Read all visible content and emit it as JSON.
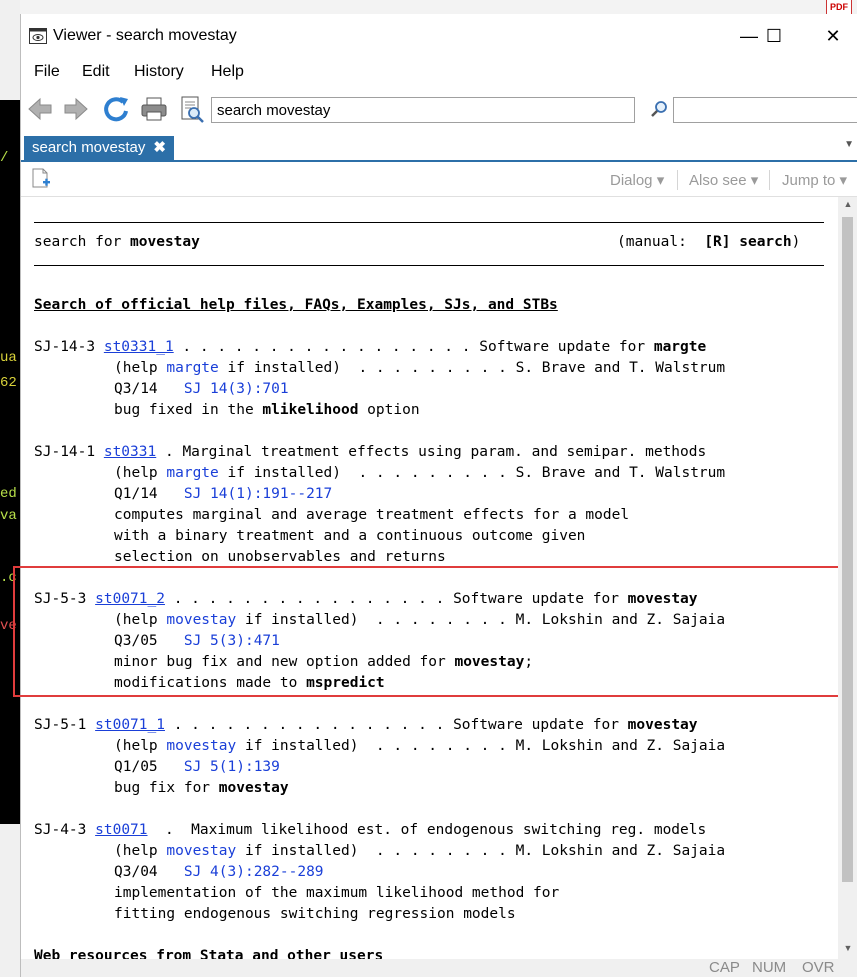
{
  "window": {
    "title": "Viewer - search movestay",
    "controls": {
      "minimize": "—",
      "maximize": "☐",
      "close": "✕"
    }
  },
  "menu": [
    "File",
    "Edit",
    "History",
    "Help"
  ],
  "toolbar": {
    "search_value": "search movestay",
    "find_value": ""
  },
  "tab": {
    "label": "search movestay",
    "close": "✖",
    "more": "▼"
  },
  "subtoolbar": {
    "dialog": "Dialog",
    "also_see": "Also see",
    "jump_to": "Jump to"
  },
  "console_fragments": [
    "/",
    "ua",
    "62",
    "ed",
    "va",
    ".c",
    "ve"
  ],
  "header": {
    "left_prefix": "search for ",
    "left_term": "movestay",
    "right_prefix": "(manual:  ",
    "right_ref": "[R] search",
    "right_suffix": ")"
  },
  "section_title": "Search of official help files, FAQs, Examples, SJs, and STBs",
  "entries": [
    {
      "id": "SJ-14-3",
      "link": "st0331_1",
      "dots": " . . . . . . . . . . . . . . . . . ",
      "desc_pre": "Software update for ",
      "desc_bold": "margte",
      "desc_post": "",
      "help_pre": "(help ",
      "help_cmd": "margte",
      "help_post": " if installed)  . . . . . . . . . ",
      "authors": "S. Brave and T. Walstrum",
      "issue": "Q3/14",
      "sj": "SJ 14(3):701",
      "notes": [
        {
          "pre": "bug fixed in the ",
          "bold": "mlikelihood",
          "post": " option"
        }
      ]
    },
    {
      "id": "SJ-14-1",
      "link": "st0331",
      "dots": " . ",
      "desc_pre": "Marginal treatment effects using param. and semipar. methods",
      "desc_bold": "",
      "desc_post": "",
      "help_pre": "(help ",
      "help_cmd": "margte",
      "help_post": " if installed)  . . . . . . . . . ",
      "authors": "S. Brave and T. Walstrum",
      "issue": "Q1/14",
      "sj": "SJ 14(1):191--217",
      "notes": [
        {
          "pre": "computes marginal and average treatment effects for a model",
          "bold": "",
          "post": ""
        },
        {
          "pre": "with a binary treatment and a continuous outcome given",
          "bold": "",
          "post": ""
        },
        {
          "pre": "selection on unobservables and returns",
          "bold": "",
          "post": ""
        }
      ]
    },
    {
      "id": "SJ-5-3",
      "link": "st0071_2",
      "dots": " . . . . . . . . . . . . . . . . ",
      "desc_pre": "Software update for ",
      "desc_bold": "movestay",
      "desc_post": "",
      "help_pre": "(help ",
      "help_cmd": "movestay",
      "help_post": " if installed)  . . . . . . . . ",
      "authors": "M. Lokshin and Z. Sajaia",
      "issue": "Q3/05",
      "sj": "SJ 5(3):471",
      "notes": [
        {
          "pre": "minor bug fix and new option added for ",
          "bold": "movestay",
          "post": ";"
        },
        {
          "pre": "modifications made to ",
          "bold": "mspredict",
          "post": ""
        }
      ]
    },
    {
      "id": "SJ-5-1",
      "link": "st0071_1",
      "dots": " . . . . . . . . . . . . . . . . ",
      "desc_pre": "Software update for ",
      "desc_bold": "movestay",
      "desc_post": "",
      "help_pre": "(help ",
      "help_cmd": "movestay",
      "help_post": " if installed)  . . . . . . . . ",
      "authors": "M. Lokshin and Z. Sajaia",
      "issue": "Q1/05",
      "sj": "SJ 5(1):139",
      "notes": [
        {
          "pre": "bug fix for ",
          "bold": "movestay",
          "post": ""
        }
      ]
    },
    {
      "id": "SJ-4-3",
      "link": "st0071",
      "dots": "  .  ",
      "desc_pre": "Maximum likelihood est. of endogenous switching reg. models",
      "desc_bold": "",
      "desc_post": "",
      "help_pre": "(help ",
      "help_cmd": "movestay",
      "help_post": " if installed)  . . . . . . . . ",
      "authors": "M. Lokshin and Z. Sajaia",
      "issue": "Q3/04",
      "sj": "SJ 4(3):282--289",
      "notes": [
        {
          "pre": "implementation of the maximum likelihood method for",
          "bold": "",
          "post": ""
        },
        {
          "pre": "fitting endogenous switching regression models",
          "bold": "",
          "post": ""
        }
      ]
    }
  ],
  "next_section": "Web resources from Stata and other users",
  "status": {
    "cap": "CAP",
    "num": "NUM",
    "ovr": "OVR"
  },
  "colors": {
    "tab_accent": "#2c6fa8",
    "link": "#1a3fd8",
    "highlight_border": "#e03c3c",
    "console_green": "#b8e04a"
  }
}
